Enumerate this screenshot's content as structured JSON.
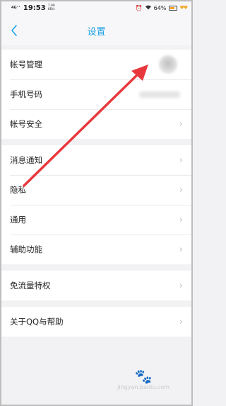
{
  "status_bar": {
    "signal": "4G⁺⁺",
    "time": "19:53",
    "speed": "7.90\nKB/s",
    "battery": "64%"
  },
  "nav": {
    "title": "设置"
  },
  "groups": [
    {
      "items": [
        {
          "label": "帐号管理"
        },
        {
          "label": "手机号码"
        },
        {
          "label": "帐号安全"
        }
      ]
    },
    {
      "items": [
        {
          "label": "消息通知"
        },
        {
          "label": "隐私"
        },
        {
          "label": "通用"
        },
        {
          "label": "辅助功能"
        }
      ]
    },
    {
      "items": [
        {
          "label": "免流量特权"
        }
      ]
    },
    {
      "items": [
        {
          "label": "关于QQ与帮助"
        }
      ]
    }
  ],
  "watermark": {
    "text": "jingyan.baidu.com"
  },
  "colors": {
    "accent": "#1fa3e6",
    "annotation_arrow": "#e8383d",
    "background": "#f2f2f4"
  }
}
